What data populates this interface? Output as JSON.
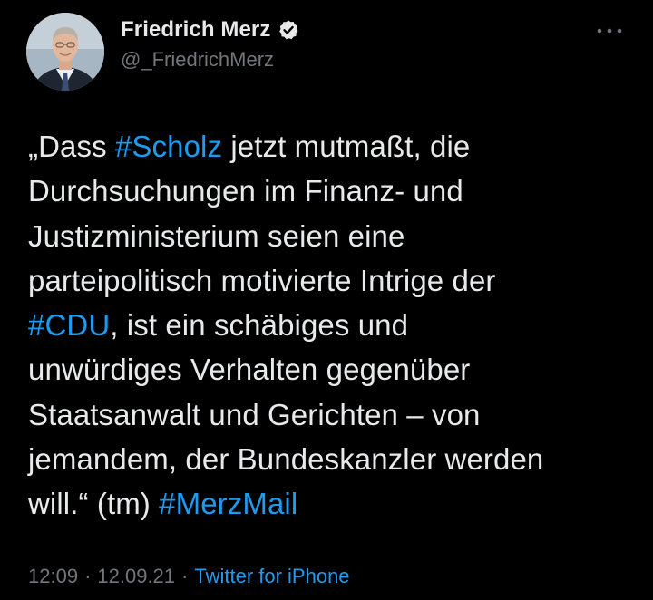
{
  "author": {
    "display_name": "Friedrich Merz",
    "handle": "@_FriedrichMerz",
    "verified_icon": "verified-badge-icon"
  },
  "menu": {
    "icon": "more-horizontal-icon"
  },
  "tweet": {
    "lines": [
      [
        {
          "text": "„Dass "
        },
        {
          "text": "#Scholz",
          "hashtag": true
        },
        {
          "text": " jetzt mutmaßt, die"
        }
      ],
      [
        {
          "text": "Durchsuchungen im Finanz- und"
        }
      ],
      [
        {
          "text": "Justizministerium seien eine"
        }
      ],
      [
        {
          "text": "parteipolitisch motivierte Intrige der"
        }
      ],
      [
        {
          "text": "#CDU",
          "hashtag": true
        },
        {
          "text": ", ist ein schäbiges und"
        }
      ],
      [
        {
          "text": "unwürdiges Verhalten gegenüber"
        }
      ],
      [
        {
          "text": "Staatsanwalt und Gerichten – von"
        }
      ],
      [
        {
          "text": "jemandem, der Bundeskanzler werden"
        }
      ],
      [
        {
          "text": "will.“ (tm) "
        },
        {
          "text": "#MerzMail",
          "hashtag": true
        }
      ]
    ]
  },
  "meta": {
    "time": "12:09",
    "separator": "·",
    "date": "12.09.21",
    "source": "Twitter for iPhone"
  },
  "colors": {
    "background": "#000000",
    "text": "#e7e9ea",
    "secondary": "#71767b",
    "link": "#1d9bf0"
  }
}
